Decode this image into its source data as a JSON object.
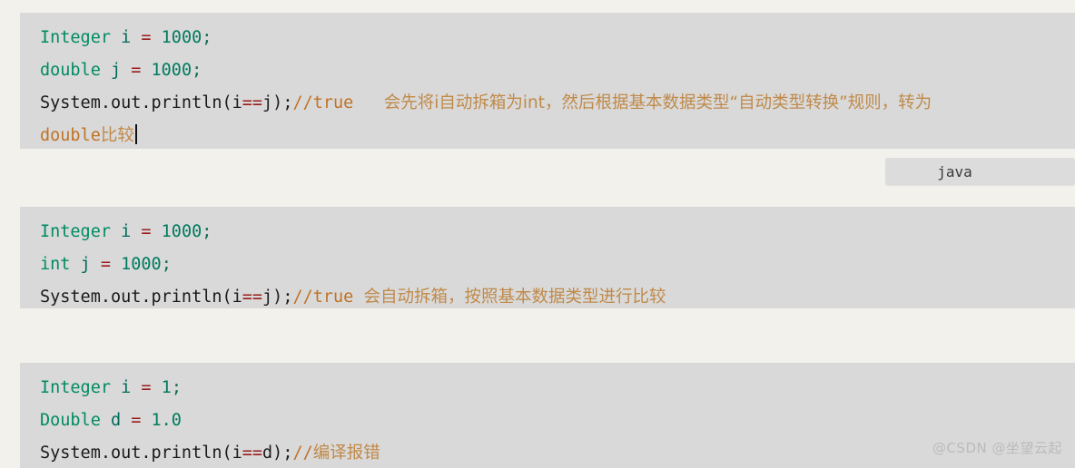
{
  "page": {
    "background_color": "#f2f1ec",
    "code_block_color": "#d9d9d9"
  },
  "colors": {
    "keyword_type": "#008b62",
    "operator": "#9b1b1b",
    "number": "#007a5e",
    "comment": "#bf7326",
    "comment_cn": "#c08a4a",
    "plain_text": "#1a1a1a",
    "label_bg": "#dcdcdc"
  },
  "language_label": {
    "text": "java"
  },
  "watermark": {
    "text": "@CSDN @坐望云起"
  },
  "code_blocks": [
    {
      "id": "block-1",
      "lines": [
        {
          "tokens": [
            {
              "text": "Integer",
              "type": "type"
            },
            {
              "text": " i ",
              "type": "ident"
            },
            {
              "text": "=",
              "type": "op"
            },
            {
              "text": " ",
              "type": "plain"
            },
            {
              "text": "1000",
              "type": "num"
            },
            {
              "text": ";",
              "type": "punc"
            }
          ]
        },
        {
          "tokens": [
            {
              "text": "double",
              "type": "type"
            },
            {
              "text": " j ",
              "type": "ident"
            },
            {
              "text": "=",
              "type": "op"
            },
            {
              "text": " ",
              "type": "plain"
            },
            {
              "text": "1000",
              "type": "num"
            },
            {
              "text": ";",
              "type": "punc"
            }
          ]
        },
        {
          "tokens": [
            {
              "text": "System.out.println(i",
              "type": "plain"
            },
            {
              "text": "==",
              "type": "op"
            },
            {
              "text": "j);",
              "type": "plain"
            },
            {
              "text": "//true",
              "type": "cmt"
            },
            {
              "text": "   ",
              "type": "cmt"
            },
            {
              "text": "会先将i自动拆箱为int，然后根据基本数据类型“自动类型转换”规则，转为",
              "type": "cmt-cn"
            }
          ]
        },
        {
          "tokens": [
            {
              "text": "double",
              "type": "cmt"
            },
            {
              "text": "比较",
              "type": "cmt-cn"
            }
          ],
          "caret": true
        }
      ]
    },
    {
      "id": "block-2",
      "lines": [
        {
          "tokens": [
            {
              "text": "Integer",
              "type": "type"
            },
            {
              "text": " i ",
              "type": "ident"
            },
            {
              "text": "=",
              "type": "op"
            },
            {
              "text": " ",
              "type": "plain"
            },
            {
              "text": "1000",
              "type": "num"
            },
            {
              "text": ";",
              "type": "punc"
            }
          ]
        },
        {
          "tokens": [
            {
              "text": "int",
              "type": "type"
            },
            {
              "text": " j ",
              "type": "ident"
            },
            {
              "text": "=",
              "type": "op"
            },
            {
              "text": " ",
              "type": "plain"
            },
            {
              "text": "1000",
              "type": "num"
            },
            {
              "text": ";",
              "type": "punc"
            }
          ]
        },
        {
          "tokens": [
            {
              "text": "System.out.println(i",
              "type": "plain"
            },
            {
              "text": "==",
              "type": "op"
            },
            {
              "text": "j);",
              "type": "plain"
            },
            {
              "text": "//true",
              "type": "cmt"
            },
            {
              "text": " ",
              "type": "cmt"
            },
            {
              "text": "会自动拆箱，按照基本数据类型进行比较",
              "type": "cmt-cn"
            }
          ]
        }
      ]
    },
    {
      "id": "block-3",
      "lines": [
        {
          "tokens": [
            {
              "text": "Integer",
              "type": "type"
            },
            {
              "text": " i ",
              "type": "ident"
            },
            {
              "text": "=",
              "type": "op"
            },
            {
              "text": " ",
              "type": "plain"
            },
            {
              "text": "1",
              "type": "num"
            },
            {
              "text": ";",
              "type": "punc"
            }
          ]
        },
        {
          "tokens": [
            {
              "text": "Double",
              "type": "type"
            },
            {
              "text": " d ",
              "type": "ident"
            },
            {
              "text": "=",
              "type": "op"
            },
            {
              "text": " ",
              "type": "plain"
            },
            {
              "text": "1.0",
              "type": "num"
            }
          ]
        },
        {
          "tokens": [
            {
              "text": "System.out.println(i",
              "type": "plain"
            },
            {
              "text": "==",
              "type": "op"
            },
            {
              "text": "d);",
              "type": "plain"
            },
            {
              "text": "//",
              "type": "cmt"
            },
            {
              "text": "编译报错",
              "type": "cmt-cn"
            }
          ]
        }
      ]
    }
  ]
}
